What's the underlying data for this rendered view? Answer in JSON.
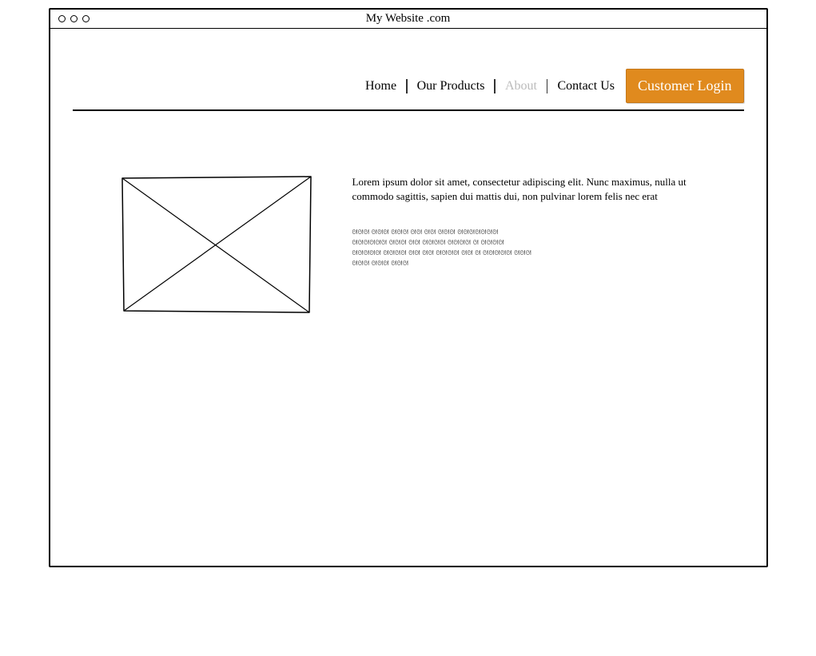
{
  "browser": {
    "title": "My Website .com"
  },
  "nav": {
    "items": [
      {
        "label": "Home",
        "muted": false
      },
      {
        "label": "Our Products",
        "muted": false
      },
      {
        "label": "About",
        "muted": true
      },
      {
        "label": "Contact Us",
        "muted": false
      }
    ],
    "login_label": "Customer Login"
  },
  "content": {
    "intro": "Lorem ipsum dolor sit amet, consectetur adipiscing elit. Nunc maximus, nulla ut commodo sagittis, sapien dui mattis dui, non pulvinar lorem felis nec erat",
    "scribble_line1": "ᘛᘛᘛ ᘛᘛᘛ ᘛᘛᘛ ᘛᘛ ᘛᘛ ᘛᘛᘛ  ᘛᘛᘛᘛᘛᘛᘛ",
    "scribble_line2": "ᘛᘛᘛᘛᘛᘛ ᘛᘛᘛ ᘛᘛ ᘛᘛᘛᘛ ᘛᘛᘛᘛ ᘛ ᘛᘛᘛᘛ",
    "scribble_line3": "ᘛᘛᘛᘛᘛ  ᘛᘛᘛᘛ ᘛᘛ ᘛᘛ ᘛᘛᘛᘛ ᘛᘛ ᘛ ᘛᘛᘛᘛᘛ ᘛᘛᘛ",
    "scribble_line4": "ᘛᘛᘛ ᘛᘛᘛ ᘛᘛᘛ"
  }
}
